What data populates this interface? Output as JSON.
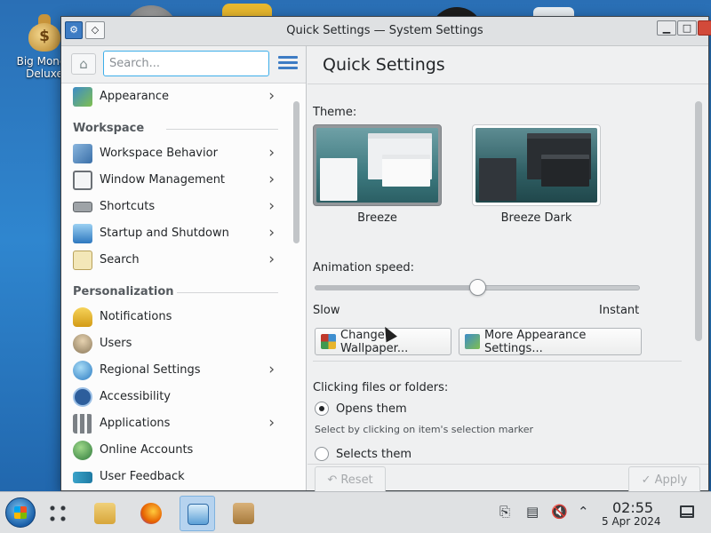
{
  "desktop": {
    "icon_label": "Big Money Deluxe"
  },
  "window": {
    "title": "Quick Settings — System Settings",
    "pin_glyph": "◇",
    "minimize_glyph": "▁",
    "maximize_glyph": "□",
    "close_glyph": "✕"
  },
  "sidebar": {
    "search_placeholder": "Search...",
    "home_glyph": "⌂",
    "chevron": "›",
    "top_item": {
      "label": "Appearance",
      "icon_color": "#3d8cc9",
      "has_chevron": true
    },
    "workspace": {
      "header": "Workspace",
      "items": [
        {
          "label": "Workspace Behavior",
          "icon_color": "#5a8fc4",
          "has_chevron": true
        },
        {
          "label": "Window Management",
          "icon_color": "#6b7075",
          "has_chevron": true
        },
        {
          "label": "Shortcuts",
          "icon_color": "#7f8589",
          "has_chevron": true
        },
        {
          "label": "Startup and Shutdown",
          "icon_color": "#4a90c8",
          "has_chevron": true
        },
        {
          "label": "Search",
          "icon_color": "#d8c27a",
          "has_chevron": true
        }
      ]
    },
    "personalization": {
      "header": "Personalization",
      "items": [
        {
          "label": "Notifications",
          "icon_color": "#e8b52c",
          "has_chevron": false
        },
        {
          "label": "Users",
          "icon_color": "#8c7a5c",
          "has_chevron": false
        },
        {
          "label": "Regional Settings",
          "icon_color": "#3f8fd0",
          "has_chevron": true
        },
        {
          "label": "Accessibility",
          "icon_color": "#2d5e9c",
          "has_chevron": false
        },
        {
          "label": "Applications",
          "icon_color": "#7b8085",
          "has_chevron": true
        },
        {
          "label": "Online Accounts",
          "icon_color": "#3f9a4f",
          "has_chevron": false
        },
        {
          "label": "User Feedback",
          "icon_color": "#3aa3c9",
          "has_chevron": false
        }
      ]
    }
  },
  "main": {
    "title": "Quick Settings",
    "theme_label": "Theme:",
    "themes": [
      {
        "name": "Breeze",
        "selected": true
      },
      {
        "name": "Breeze Dark",
        "selected": false
      }
    ],
    "animation_label": "Animation speed:",
    "animation_speed": 0.5,
    "slow_label": "Slow",
    "instant_label": "Instant",
    "change_wallpaper_label": "Change Wallpaper...",
    "more_appearance_label": "More Appearance Settings...",
    "clicking_label": "Clicking files or folders:",
    "opens_them_label": "Opens them",
    "opens_them_hint": "Select by clicking on item's selection marker",
    "selects_them_label": "Selects them",
    "selected_click_option": "opens",
    "reset_label": "Reset",
    "apply_label": "Apply"
  },
  "taskbar": {
    "time": "02:55",
    "date": "5 Apr 2024",
    "tray_glyphs": {
      "chevron": "⌃",
      "mute": "🔇"
    }
  }
}
